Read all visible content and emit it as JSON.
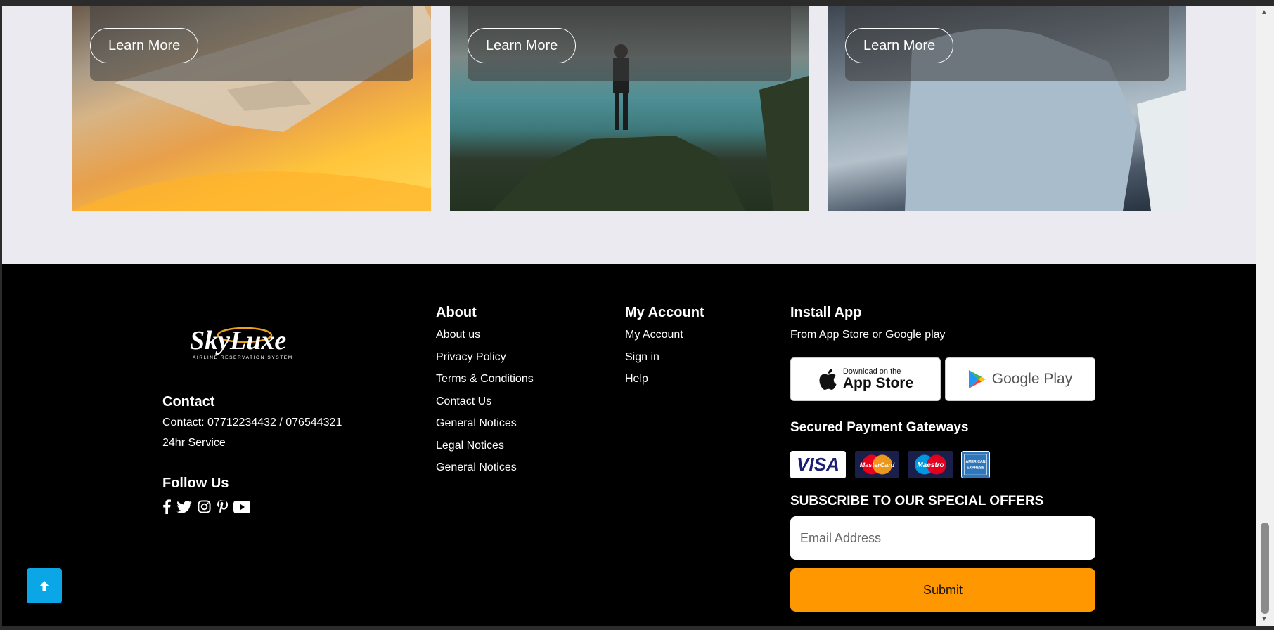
{
  "cards": [
    {
      "button": "Learn More"
    },
    {
      "button": "Learn More"
    },
    {
      "button": "Learn More"
    }
  ],
  "footer": {
    "logo": {
      "name": "SkyLuxe",
      "tagline": "AIRLINE RESERVATION SYSTEM"
    },
    "contact": {
      "heading": "Contact",
      "phone": "Contact: 07712234432 / 076544321",
      "service": "24hr Service"
    },
    "follow": {
      "heading": "Follow Us",
      "icons": [
        "facebook-icon",
        "twitter-icon",
        "instagram-icon",
        "pinterest-icon",
        "youtube-icon"
      ]
    },
    "about": {
      "heading": "About",
      "links": [
        "About us",
        "Privacy Policy",
        "Terms & Conditions",
        "Contact Us",
        "General Notices",
        "Legal Notices",
        "General Notices"
      ]
    },
    "account": {
      "heading": "My Account",
      "links": [
        "My Account",
        "Sign in",
        "Help"
      ]
    },
    "app": {
      "heading": "Install App",
      "subtext": "From App Store or Google play",
      "appstore_small": "Download on the",
      "appstore_big": "App Store",
      "googleplay": "Google Play"
    },
    "payments": {
      "heading": "Secured Payment Gateways",
      "cards": [
        "VISA",
        "MasterCard",
        "Maestro",
        "AMERICAN EXPRESS"
      ]
    },
    "subscribe": {
      "heading": "SUBSCRIBE TO OUR SPECIAL OFFERS",
      "email_placeholder": "Email Address",
      "submit_label": "Submit"
    }
  },
  "colors": {
    "accent": "#ff9800",
    "to_top": "#0ba6e6",
    "footer_bg": "#000000",
    "page_bg": "#ebeaf1"
  }
}
